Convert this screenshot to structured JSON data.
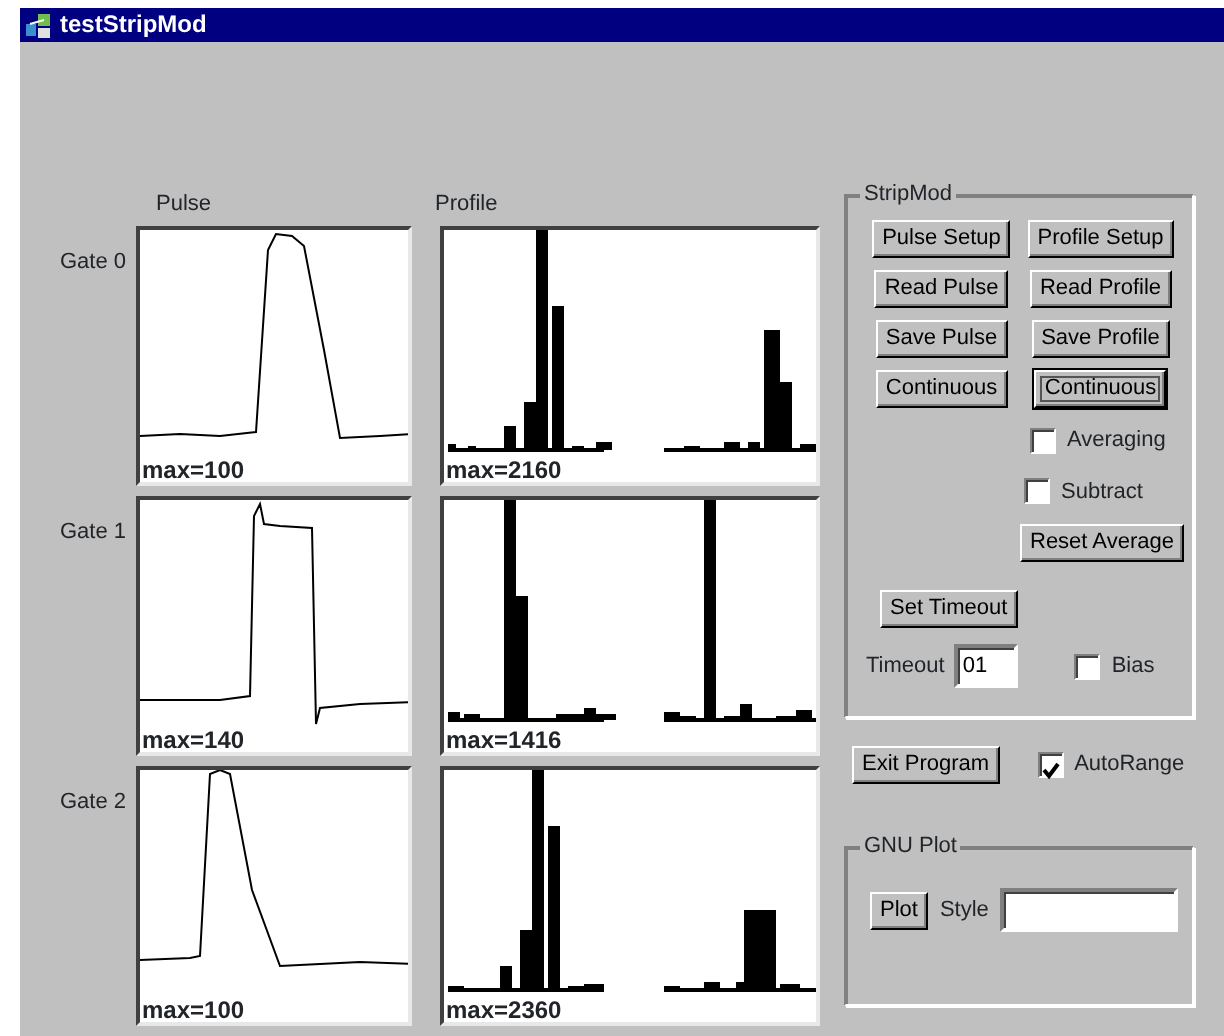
{
  "window": {
    "title": "testStripMod"
  },
  "columns": [
    "Pulse",
    "Profile"
  ],
  "gates": [
    {
      "label": "Gate 0",
      "pulse_max": "max=100",
      "profile_max": "max=2160"
    },
    {
      "label": "Gate 1",
      "pulse_max": "max=140",
      "profile_max": "max=1416"
    },
    {
      "label": "Gate 2",
      "pulse_max": "max=100",
      "profile_max": "max=2360"
    }
  ],
  "stripmod": {
    "title": "StripMod",
    "buttons": [
      {
        "label": "Pulse Setup",
        "focused": false
      },
      {
        "label": "Profile Setup",
        "focused": false
      },
      {
        "label": "Read Pulse",
        "focused": false
      },
      {
        "label": "Read Profile",
        "focused": false
      },
      {
        "label": "Save Pulse",
        "focused": false
      },
      {
        "label": "Save Profile",
        "focused": false
      },
      {
        "label": "Continuous",
        "focused": false
      },
      {
        "label": "Continuous",
        "focused": true
      }
    ],
    "averaging": {
      "label": "Averaging",
      "checked": false
    },
    "subtract": {
      "label": "Subtract",
      "checked": false
    },
    "reset_button": "Reset Average",
    "set_timeout_button": "Set Timeout",
    "timeout": {
      "label": "Timeout",
      "value": "01"
    },
    "bias": {
      "label": "Bias",
      "checked": false
    }
  },
  "exit_button": "Exit Program",
  "autorange": {
    "label": "AutoRange",
    "checked": true
  },
  "gnu_plot": {
    "title": "GNU Plot",
    "plot_button": "Plot",
    "style": {
      "label": "Style"
    }
  }
}
